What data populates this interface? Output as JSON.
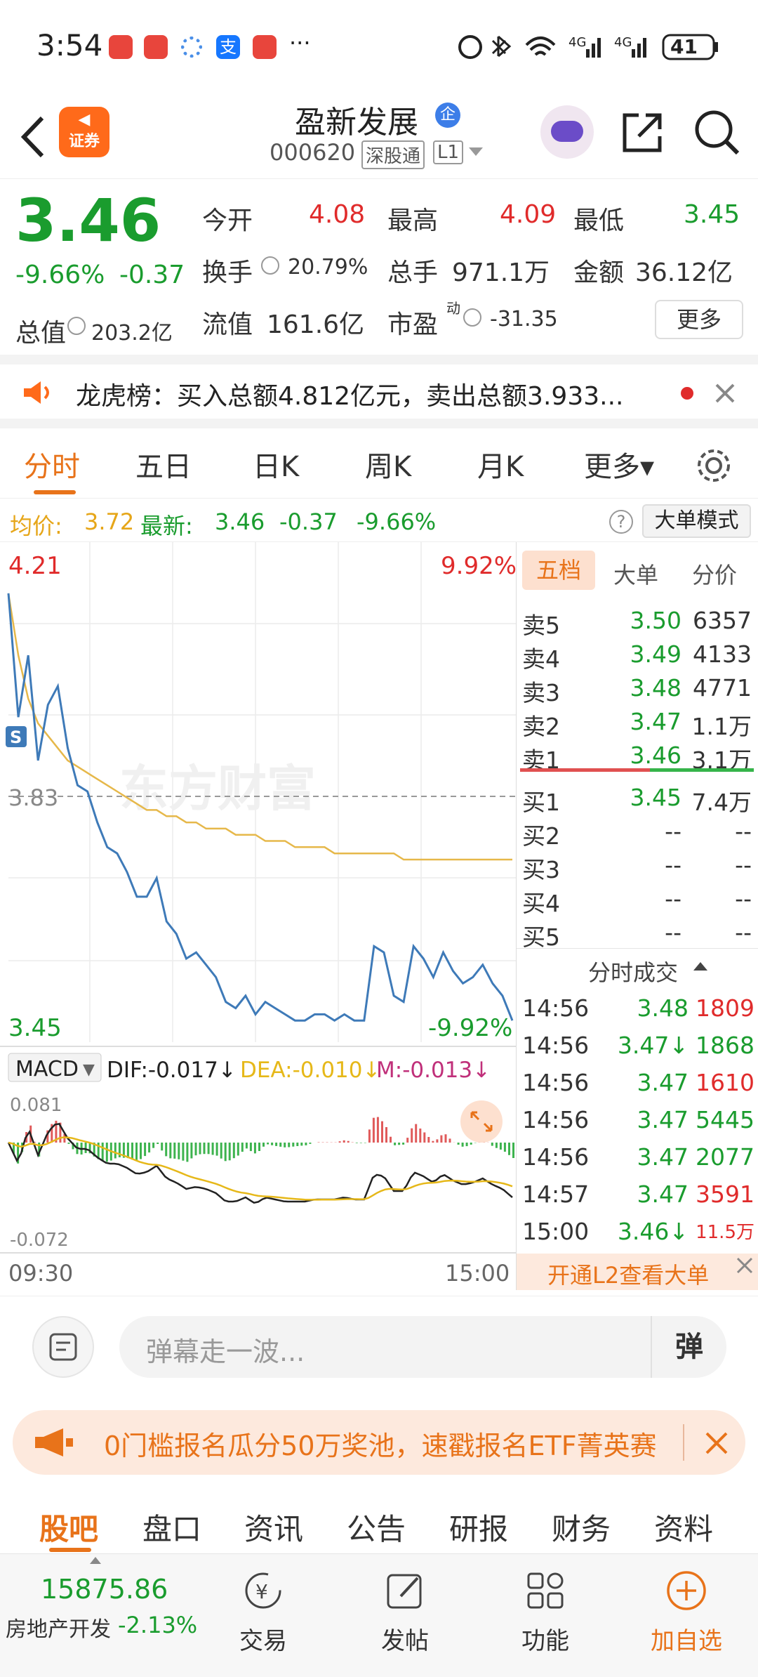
{
  "status_bar": {
    "time": "3:54",
    "battery": "41"
  },
  "header": {
    "back_label": "‹",
    "broker_badge": "证券",
    "stock_name": "盈新发展",
    "company_tag": "企",
    "stock_code": "000620",
    "exchange_tag": "深股通",
    "level_tag": "L1"
  },
  "quote": {
    "price": "3.46",
    "change_pct": "-9.66%",
    "change_amt": "-0.37",
    "open_label": "今开",
    "open": "4.08",
    "high_label": "最高",
    "high": "4.09",
    "low_label": "最低",
    "low": "3.45",
    "turnover_label": "换手",
    "turnover": "20.79%",
    "volume_label": "总手",
    "volume": "971.1万",
    "amount_label": "金额",
    "amount": "36.12亿",
    "mktcap_label": "总值",
    "mktcap": "203.2亿",
    "float_label": "流值",
    "float": "161.6亿",
    "pe_label": "市盈",
    "pe_sup": "动",
    "pe": "-31.35",
    "more_label": "更多"
  },
  "notice": {
    "text": "龙虎榜：买入总额4.812亿元，卖出总额3.933..."
  },
  "tabs": [
    {
      "label": "分时"
    },
    {
      "label": "五日"
    },
    {
      "label": "日K"
    },
    {
      "label": "周K"
    },
    {
      "label": "月K"
    },
    {
      "label": "更多▾"
    }
  ],
  "avg_bar": {
    "avg_label": "均价:",
    "avg": "3.72",
    "latest_label": "最新:",
    "latest": "3.46",
    "chg": "-0.37",
    "pct": "-9.66%",
    "mode_label": "大单模式"
  },
  "chart": {
    "top_price": "4.21",
    "top_pct": "9.92%",
    "mid_price": "3.83",
    "bottom_price": "3.45",
    "bottom_pct": "-9.92%",
    "watermark": "东方财富",
    "macd_label": "MACD",
    "dif": "DIF:-0.017↓",
    "dea": "DEA:-0.010↓",
    "m": "M:-0.013↓",
    "macd_top": "0.081",
    "macd_bottom": "-0.072",
    "time_start": "09:30",
    "time_end": "15:00"
  },
  "chart_data": {
    "type": "line",
    "title": "",
    "ylim": [
      3.45,
      4.21
    ],
    "series": [
      {
        "values": [
          4.15,
          3.95,
          4.05,
          3.88,
          3.97,
          4.0,
          3.9,
          3.84,
          3.83,
          3.78,
          3.74,
          3.73,
          3.7,
          3.66,
          3.66,
          3.69,
          3.62,
          3.6,
          3.56,
          3.57,
          3.55,
          3.53,
          3.49,
          3.48,
          3.5,
          3.47,
          3.49,
          3.48,
          3.47,
          3.46,
          3.46,
          3.47,
          3.47,
          3.46,
          3.47,
          3.46,
          3.46,
          3.58,
          3.57,
          3.5,
          3.49,
          3.58,
          3.56,
          3.53,
          3.57,
          3.54,
          3.52,
          3.53,
          3.55,
          3.52,
          3.5,
          3.46
        ]
      },
      {
        "values": [
          4.15,
          4.05,
          3.98,
          3.94,
          3.92,
          3.9,
          3.88,
          3.87,
          3.86,
          3.85,
          3.84,
          3.83,
          3.82,
          3.81,
          3.8,
          3.8,
          3.79,
          3.79,
          3.78,
          3.78,
          3.77,
          3.77,
          3.77,
          3.76,
          3.76,
          3.76,
          3.75,
          3.75,
          3.75,
          3.74,
          3.74,
          3.74,
          3.74,
          3.73,
          3.73,
          3.73,
          3.73,
          3.73,
          3.73,
          3.73,
          3.72,
          3.72,
          3.72,
          3.72,
          3.72,
          3.72,
          3.72,
          3.72,
          3.72,
          3.72,
          3.72,
          3.72
        ]
      }
    ]
  },
  "order_book": {
    "tabs": [
      "五档",
      "大单",
      "分价"
    ],
    "asks": [
      {
        "label": "卖5",
        "price": "3.50",
        "vol": "6357"
      },
      {
        "label": "卖4",
        "price": "3.49",
        "vol": "4133"
      },
      {
        "label": "卖3",
        "price": "3.48",
        "vol": "4771"
      },
      {
        "label": "卖2",
        "price": "3.47",
        "vol": "1.1万"
      },
      {
        "label": "卖1",
        "price": "3.46",
        "vol": "3.1万"
      }
    ],
    "bids": [
      {
        "label": "买1",
        "price": "3.45",
        "vol": "7.4万"
      },
      {
        "label": "买2",
        "price": "--",
        "vol": "--"
      },
      {
        "label": "买3",
        "price": "--",
        "vol": "--"
      },
      {
        "label": "买4",
        "price": "--",
        "vol": "--"
      },
      {
        "label": "买5",
        "price": "--",
        "vol": "--"
      }
    ],
    "trades_title": "分时成交",
    "trades": [
      {
        "time": "14:56",
        "price": "3.48",
        "vol": "1809"
      },
      {
        "time": "14:56",
        "price": "3.47↓",
        "vol": "1868"
      },
      {
        "time": "14:56",
        "price": "3.47",
        "vol": "1610"
      },
      {
        "time": "14:56",
        "price": "3.47",
        "vol": "5445"
      },
      {
        "time": "14:56",
        "price": "3.47",
        "vol": "2077"
      },
      {
        "time": "14:57",
        "price": "3.47",
        "vol": "3591"
      },
      {
        "time": "15:00",
        "price": "3.46↓",
        "vol": "11.5万"
      }
    ],
    "l2_label": "开通L2查看大单"
  },
  "input": {
    "placeholder": "弹幕走一波...",
    "danmu_label": "弹"
  },
  "banner": {
    "text": "0门槛报名瓜分50万奖池，速戳报名ETF菁英赛"
  },
  "subtabs": [
    "股吧",
    "盘口",
    "资讯",
    "公告",
    "研报",
    "财务",
    "资料"
  ],
  "bottom": {
    "index_value": "15875.86",
    "index_name": "房地产开发",
    "index_pct": "-2.13%",
    "nav": [
      "交易",
      "发帖",
      "功能",
      "加自选"
    ]
  }
}
